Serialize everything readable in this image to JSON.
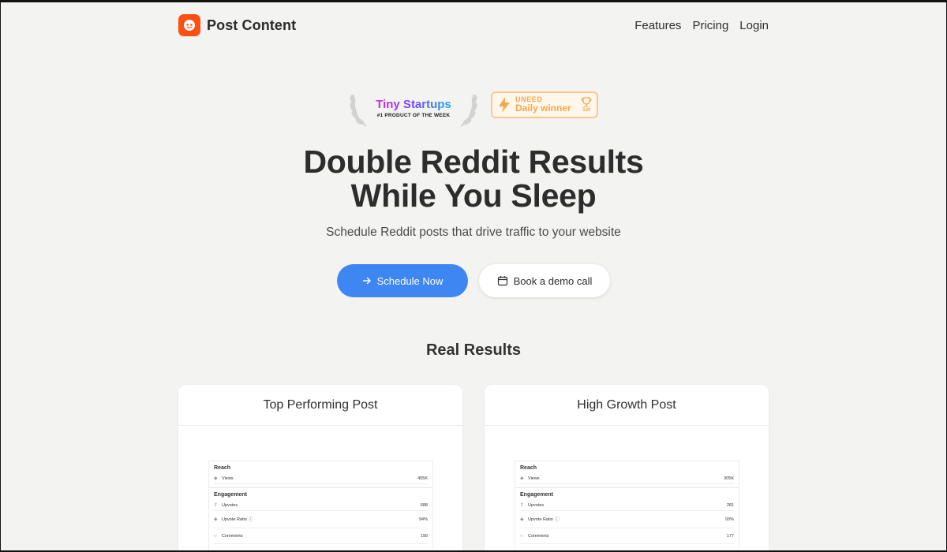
{
  "brand": {
    "name": "Post Content",
    "accent": "#ff4e12"
  },
  "nav": {
    "links": [
      "Features",
      "Pricing",
      "Login"
    ]
  },
  "badges": {
    "tiny_startups": {
      "title": "Tiny Startups",
      "subtitle": "#1 PRODUCT OF THE WEEK"
    },
    "uneed": {
      "brand": "UNEED",
      "label": "Daily winner",
      "rank": "1st",
      "color": "#f3a94a"
    }
  },
  "hero": {
    "title_line1": "Double Reddit Results",
    "title_line2": "While You Sleep",
    "subtitle": "Schedule Reddit posts that drive traffic to your website"
  },
  "cta": {
    "primary": "Schedule Now",
    "secondary": "Book a demo call",
    "primary_color": "#3e86f2"
  },
  "results": {
    "title": "Real Results",
    "cards": [
      {
        "title": "Top Performing Post",
        "reach_label": "Reach",
        "views_label": "Views",
        "views": "455K",
        "engagement_label": "Engagement",
        "upvotes_label": "Upvotes",
        "upvotes": "688",
        "ratio_label": "Upvote Ratio",
        "ratio": "94%",
        "comments_label": "Comments",
        "comments": "199"
      },
      {
        "title": "High Growth Post",
        "reach_label": "Reach",
        "views_label": "Views",
        "views": "305K",
        "engagement_label": "Engagement",
        "upvotes_label": "Upvotes",
        "upvotes": "281",
        "ratio_label": "Upvote Ratio",
        "ratio": "93%",
        "comments_label": "Comments",
        "comments": "177"
      }
    ]
  }
}
